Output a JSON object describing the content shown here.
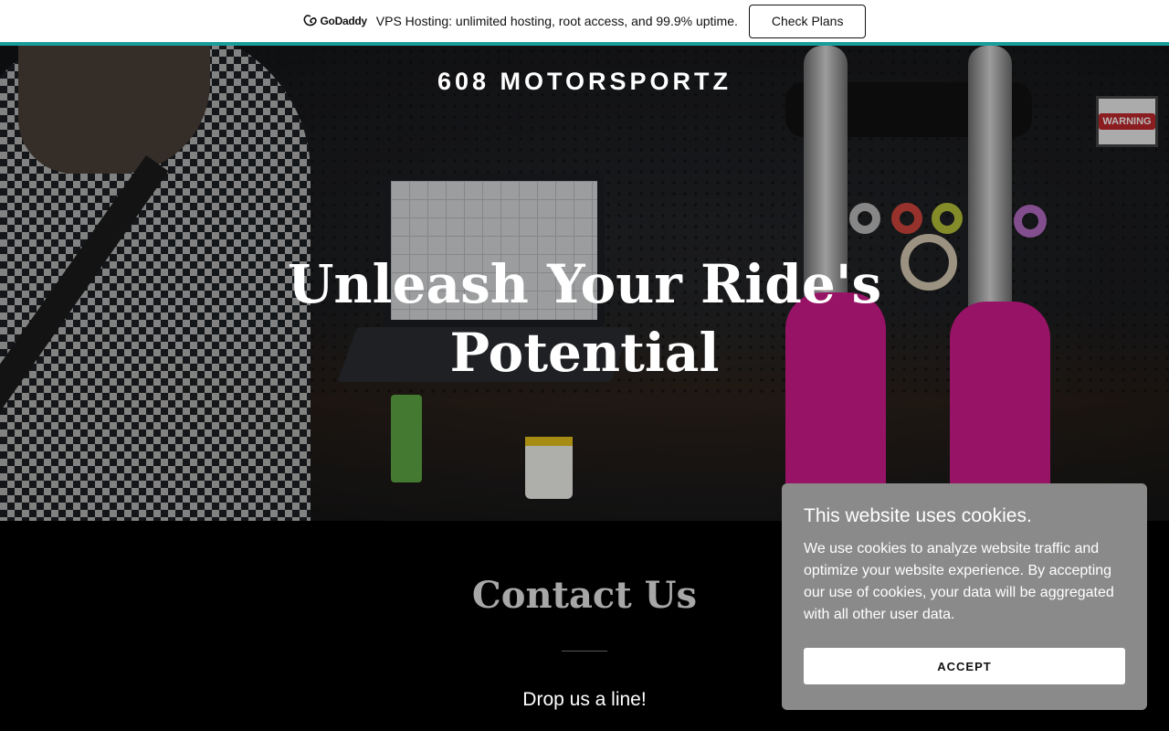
{
  "promo": {
    "logo_text": "GoDaddy",
    "text": "VPS Hosting: unlimited hosting, root access, and 99.9% uptime.",
    "button_label": "Check Plans",
    "accent_color": "#1a9e9c"
  },
  "hero": {
    "brand": "608 MOTORSPORTZ",
    "headline_line1": "Unleash Your Ride's",
    "headline_line2": "Potential",
    "warning_sign": "WARNING"
  },
  "contact": {
    "title": "Contact Us",
    "subtitle": "Drop us a line!"
  },
  "cookie": {
    "title": "This website uses cookies.",
    "body": "We use cookies to analyze website traffic and optimize your website experience. By accepting our use of cookies, your data will be aggregated with all other user data.",
    "accept_label": "ACCEPT"
  }
}
